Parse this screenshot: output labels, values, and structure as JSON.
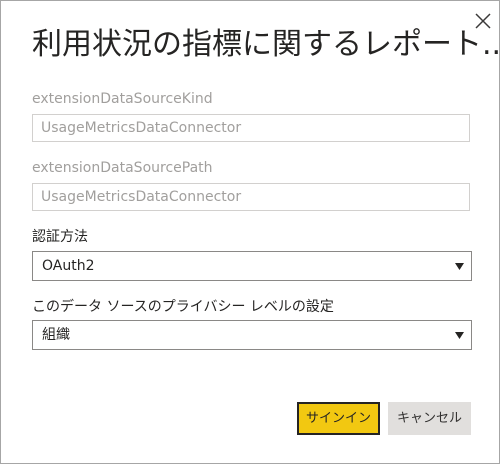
{
  "dialog": {
    "title": "利用状況の指標に関するレポート...",
    "close_icon": "close-icon"
  },
  "fields": {
    "kind": {
      "label": "extensionDataSourceKind",
      "value": "UsageMetricsDataConnector"
    },
    "path": {
      "label": "extensionDataSourcePath",
      "value": "UsageMetricsDataConnector"
    },
    "auth": {
      "label": "認証方法",
      "selected": "OAuth2"
    },
    "privacy": {
      "label": "このデータ ソースのプライバシー レベルの設定",
      "selected": "組織"
    }
  },
  "buttons": {
    "signin": "サインイン",
    "cancel": "キャンセル"
  },
  "colors": {
    "primary_button": "#f2c811",
    "secondary_button": "#e1dfdd",
    "disabled_text": "#a19f9d",
    "text": "#252423"
  }
}
